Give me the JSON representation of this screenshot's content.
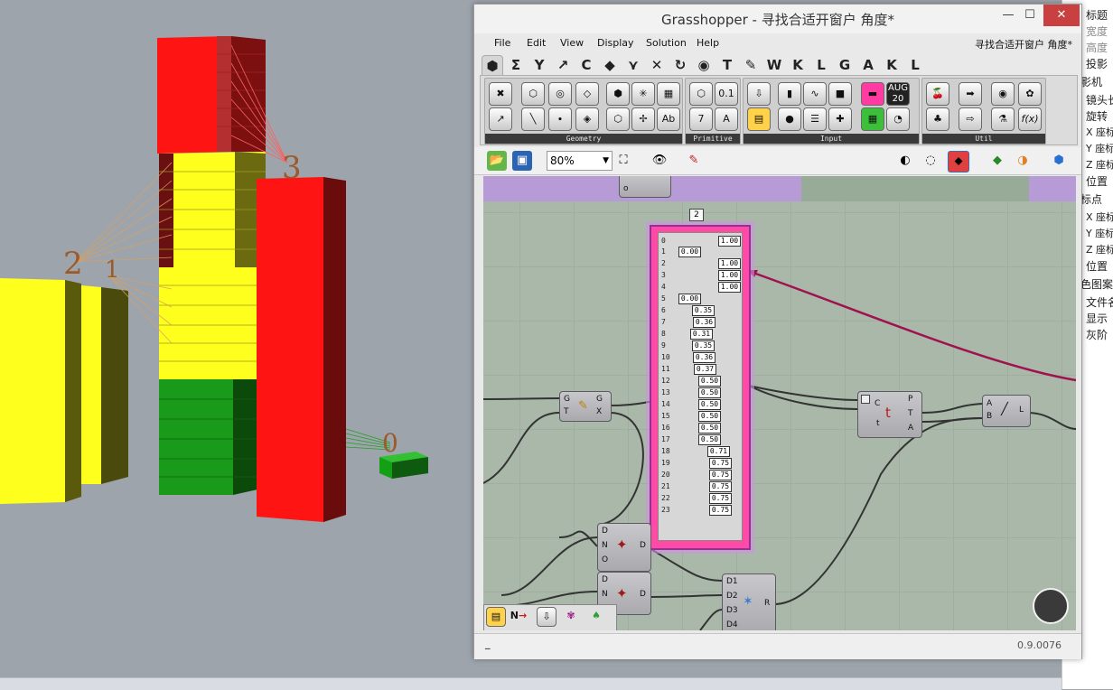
{
  "viewport": {
    "labels": [
      "2",
      "1",
      "3",
      "0"
    ]
  },
  "properties": {
    "rows": [
      "标题",
      "宽度",
      "高度",
      "投影",
      "影机",
      "镜头长",
      "旋转",
      "X 座标",
      "Y 座标",
      "Z 座标",
      "位置",
      "标点",
      "X 座标",
      "Y 座标",
      "Z 座标",
      "位置",
      "色图案",
      "文件名",
      "显示",
      "灰阶"
    ]
  },
  "gh": {
    "title": "Grasshopper - 寻找合适开窗户 角度*",
    "menu": [
      "File",
      "Edit",
      "View",
      "Display",
      "Solution",
      "Help"
    ],
    "document_name": "寻找合适开窗户 角度*",
    "tabs": [
      "Σ",
      "Y",
      "↗",
      "C",
      "◆",
      "⋎",
      "✕",
      "↻",
      "◉",
      "T",
      "✎",
      "W",
      "K",
      "L",
      "G",
      "A",
      "K",
      "L"
    ],
    "ribbon_groups": [
      "Geometry",
      "Primitive",
      "Input",
      "Util"
    ],
    "zoom": "80%",
    "canvas": {
      "group_marker": "2",
      "panel_indices": [
        "0",
        "1",
        "2",
        "3",
        "4",
        "5",
        "6",
        "7",
        "8",
        "9",
        "10",
        "11",
        "12",
        "13",
        "14",
        "15",
        "16",
        "17",
        "18",
        "19",
        "20",
        "21",
        "22",
        "23"
      ],
      "panel_values": [
        "1.00",
        "0.00",
        "1.00",
        "1.00",
        "1.00",
        "0.00",
        "0.35",
        "0.36",
        "0.31",
        "0.35",
        "0.36",
        "0.37",
        "0.50",
        "0.50",
        "0.50",
        "0.50",
        "0.50",
        "0.50",
        "0.71",
        "0.75",
        "0.75",
        "0.75",
        "0.75",
        "0.75"
      ],
      "comp_eval": {
        "in": [
          "G",
          "T"
        ],
        "out": [
          "G",
          "X"
        ]
      },
      "comp_crv": {
        "in": [
          "C",
          "t"
        ],
        "out": [
          "P",
          "T",
          "A"
        ]
      },
      "comp_line": {
        "in": [
          "A",
          "B"
        ],
        "out": [
          "L"
        ]
      },
      "comp_list1": {
        "in": [
          "D",
          "N",
          "O"
        ],
        "out": [
          "D"
        ]
      },
      "comp_list2": {
        "in": [
          "D",
          "N"
        ],
        "out": [
          "D"
        ]
      },
      "comp_merge": {
        "in": [
          "D1",
          "D2",
          "D3",
          "D4"
        ],
        "out": [
          "R"
        ]
      },
      "dock_labels": [
        "N"
      ]
    },
    "status": {
      "left": "_",
      "version": "0.9.0076"
    }
  },
  "colors": {
    "red": "#ff1a1a",
    "yellow": "#ffff22",
    "green": "#1aa01a",
    "wire": "#a0124f",
    "panel": "#ff4aa6"
  }
}
